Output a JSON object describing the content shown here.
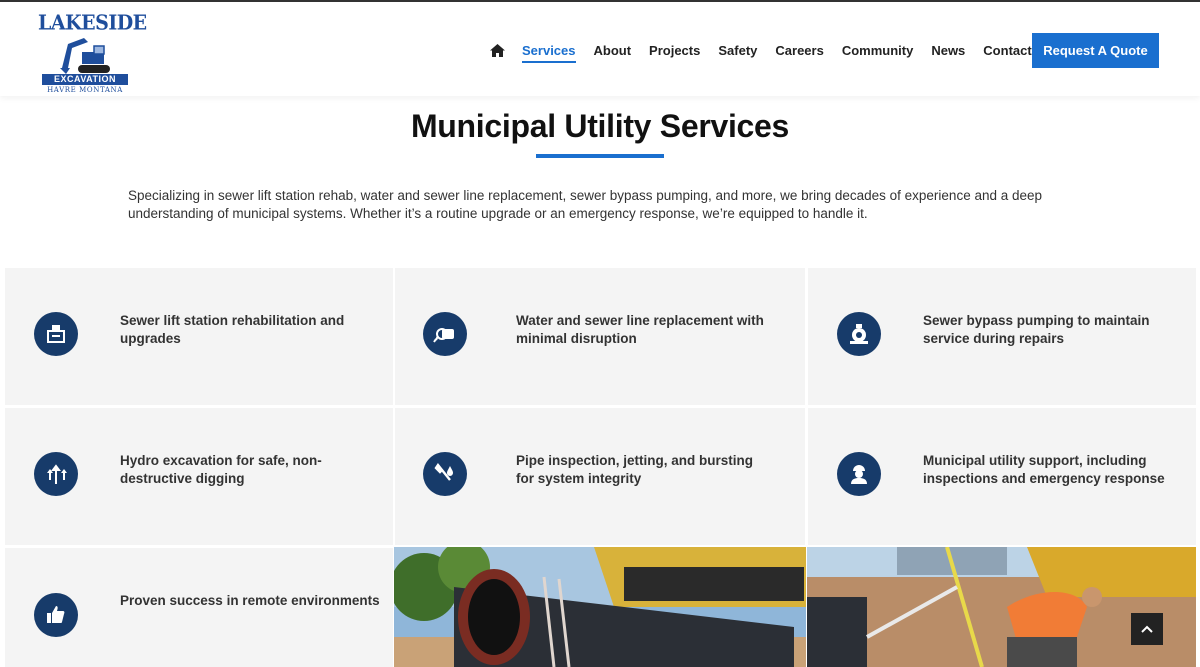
{
  "logo": {
    "brand": "LAKESIDE",
    "bar": "EXCAVATION",
    "sub": "HAVRE MONTANA"
  },
  "nav": {
    "home_icon": "home-icon",
    "items": [
      "Services",
      "About",
      "Projects",
      "Safety",
      "Careers",
      "Community",
      "News",
      "Contact"
    ],
    "active": "Services",
    "cta": "Request A Quote"
  },
  "page": {
    "title": "Municipal Utility Services",
    "intro": "Specializing in sewer lift station rehab, water and sewer line replacement, sewer bypass pumping, and more, we bring decades of experience and a deep understanding of municipal systems. Whether it’s a routine upgrade or an emergency response, we’re equipped to handle it."
  },
  "services": [
    {
      "icon": "lift-station-icon",
      "text": "Sewer lift station rehabilitation and upgrades"
    },
    {
      "icon": "pipe-flow-icon",
      "text": "Water and sewer line replacement with minimal disruption"
    },
    {
      "icon": "pump-icon",
      "text": "Sewer bypass pumping to maintain service during repairs"
    },
    {
      "icon": "split-arrows-icon",
      "text": "Hydro excavation for safe, non-destructive digging"
    },
    {
      "icon": "wrench-drop-icon",
      "text": "Pipe inspection, jetting, and bursting for system integrity"
    },
    {
      "icon": "worker-icon",
      "text": "Municipal utility support, including inspections and emergency response"
    },
    {
      "icon": "thumbs-up-icon",
      "text": "Proven success in remote environments"
    }
  ],
  "colors": {
    "accent": "#1a6fcf",
    "icon_bg": "#173b6a",
    "card_bg": "#f4f4f4"
  }
}
